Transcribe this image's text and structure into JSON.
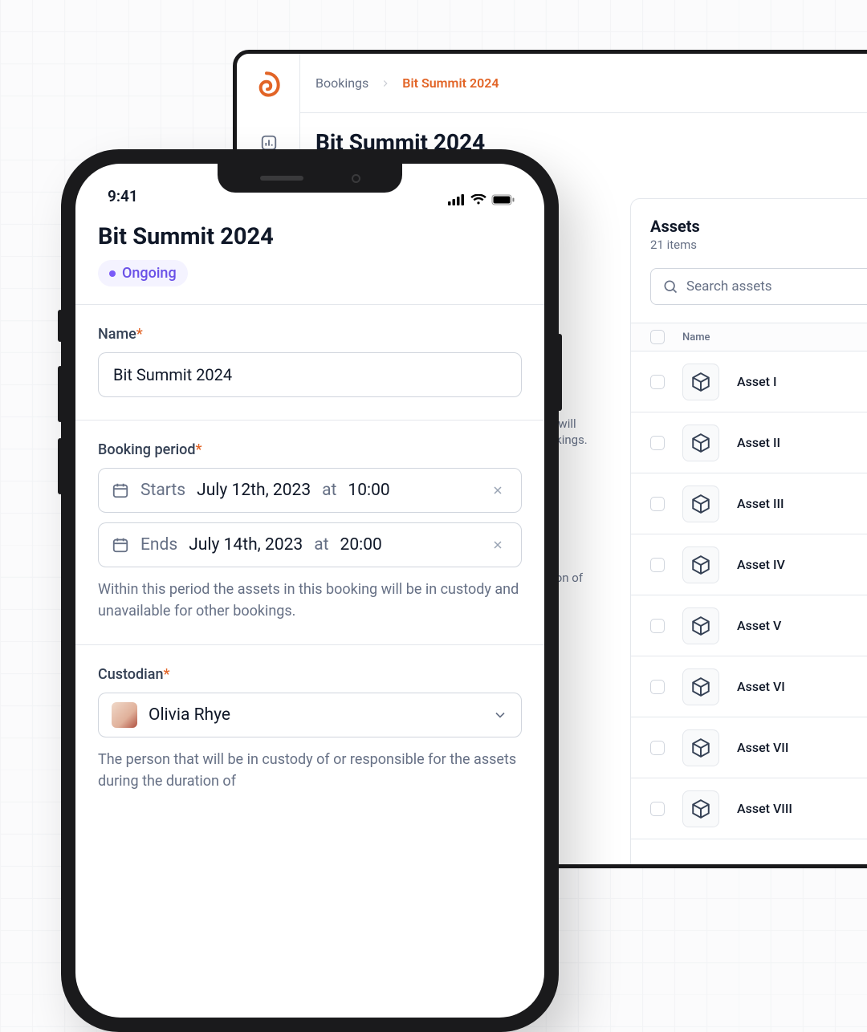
{
  "colors": {
    "accent": "#e26426",
    "border": "#e4e7ec",
    "text_muted": "#667085",
    "badge_bg": "#f4f3ff",
    "badge_text": "#6a51e7"
  },
  "desktop": {
    "breadcrumb": {
      "parent": "Bookings",
      "current": "Bit Summit 2024"
    },
    "title": "Bit Summit 2024",
    "help_fragment_1": "ng will",
    "help_fragment_2": "ookings.",
    "help_fragment_3": "ation of",
    "assets": {
      "heading": "Assets",
      "count": "21 items",
      "search_placeholder": "Search assets",
      "col_name": "Name",
      "items": [
        "Asset I",
        "Asset II",
        "Asset III",
        "Asset IV",
        "Asset V",
        "Asset VI",
        "Asset VII",
        "Asset VIII"
      ]
    }
  },
  "phone": {
    "time": "9:41",
    "title": "Bit Summit 2024",
    "status": "Ongoing",
    "name_label": "Name",
    "name_value": "Bit Summit 2024",
    "period_label": "Booking period",
    "start": {
      "prefix": "Starts",
      "date": "July 12th, 2023",
      "at": "at",
      "time": "10:00"
    },
    "end": {
      "prefix": "Ends",
      "date": "July 14th, 2023",
      "at": "at",
      "time": "20:00"
    },
    "period_help": "Within this period the assets in this booking will be in custody and unavailable for other bookings.",
    "custodian_label": "Custodian",
    "custodian_value": "Olivia Rhye",
    "custodian_help": "The person that will be in custody of or responsible for the assets during the duration of"
  }
}
